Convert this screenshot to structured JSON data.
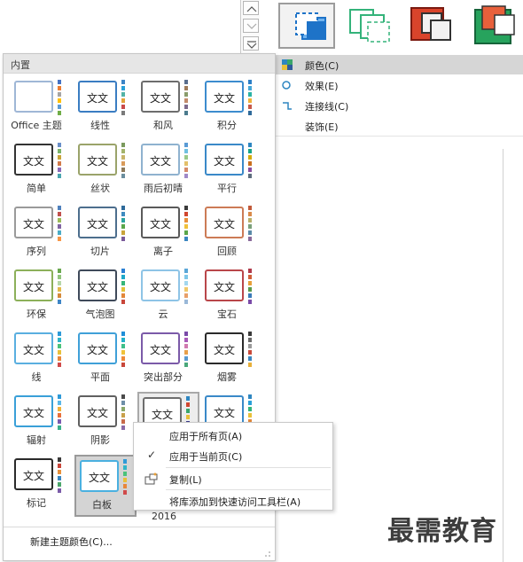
{
  "ribbon": {
    "spinner_icons": [
      "chevron-up-icon",
      "chevron-down-icon",
      "more-icon"
    ],
    "styles": [
      {
        "name": "filled-blue-style",
        "primary": "#1e73c8",
        "secondary": "#6fb3ef",
        "selected": true
      },
      {
        "name": "outline-green-style",
        "primary": "#34b37a",
        "secondary": "#ffffff",
        "selected": false
      },
      {
        "name": "filled-red-style",
        "primary": "#d9442b",
        "secondary": "#f2f2f2",
        "selected": false
      },
      {
        "name": "filled-green-style",
        "primary": "#27a35d",
        "secondary": "#e8603b",
        "selected": false
      }
    ]
  },
  "variant_menu": {
    "items": [
      {
        "label": "颜色(C)",
        "icon": "color-palette-icon",
        "active": true
      },
      {
        "label": "效果(E)",
        "icon": "effects-circle-icon",
        "active": false
      },
      {
        "label": "连接线(C)",
        "icon": "connector-icon",
        "active": false
      },
      {
        "label": "装饰(E)",
        "icon": "",
        "active": false
      }
    ]
  },
  "gallery": {
    "header": "内置",
    "thumb_text": "文文",
    "year_text": "2016",
    "themes": [
      {
        "label": "Office 主题",
        "border": "#9fb7d6",
        "palette": [
          "#4472c4",
          "#ed7d31",
          "#a5a5a5",
          "#ffc000",
          "#5b9bd5",
          "#70ad47"
        ],
        "show_text": false
      },
      {
        "label": "线性",
        "border": "#3a7dc2",
        "palette": [
          "#3d85c6",
          "#2aa0d8",
          "#53b3a6",
          "#e3a33a",
          "#c94a4a",
          "#7a7a7a"
        ],
        "show_text": true
      },
      {
        "label": "和风",
        "border": "#6d6d6d",
        "palette": [
          "#5a6e8e",
          "#a07c5b",
          "#8a9c6b",
          "#c28b6b",
          "#7d6b8d",
          "#4b7b8d"
        ],
        "show_text": true
      },
      {
        "label": "积分",
        "border": "#3c8cce",
        "palette": [
          "#2c7fc7",
          "#46a7d8",
          "#2bb3a5",
          "#f0b23a",
          "#c85a4a",
          "#2f6a9a"
        ],
        "show_text": true
      },
      {
        "label": "简单",
        "border": "#333333",
        "palette": [
          "#6a8fc9",
          "#7ab36a",
          "#c9a53a",
          "#d27a4a",
          "#8a6ab8",
          "#4aa6b0"
        ],
        "show_text": true
      },
      {
        "label": "丝状",
        "border": "#9aa36a",
        "palette": [
          "#7b9a5e",
          "#a3b36b",
          "#c8b46a",
          "#d99b5a",
          "#8d7a5b",
          "#6b8e9e"
        ],
        "show_text": true
      },
      {
        "label": "雨后初晴",
        "border": "#8fb2cf",
        "palette": [
          "#5a9bd5",
          "#70c0e0",
          "#9ac98a",
          "#e3c06a",
          "#d58a6a",
          "#a08ac8"
        ],
        "show_text": true
      },
      {
        "label": "平行",
        "border": "#3a89c8",
        "palette": [
          "#2e86c1",
          "#17a589",
          "#d4ac0d",
          "#ca6f1e",
          "#884ea0",
          "#5d6d7e"
        ],
        "show_text": true
      },
      {
        "label": "序列",
        "border": "#9a9a9a",
        "palette": [
          "#4f81bd",
          "#c0504d",
          "#9bbb59",
          "#8064a2",
          "#4bacc6",
          "#f79646"
        ],
        "show_text": true
      },
      {
        "label": "切片",
        "border": "#4d6e8d",
        "palette": [
          "#2e6a9a",
          "#3e8bc0",
          "#2ba3a0",
          "#5aa64a",
          "#c9a43a",
          "#7a5a9a"
        ],
        "show_text": true
      },
      {
        "label": "离子",
        "border": "#5a5a5a",
        "palette": [
          "#3a3a3a",
          "#d0462f",
          "#e8903a",
          "#f0c03a",
          "#5aa64a",
          "#3a86c0"
        ],
        "show_text": true
      },
      {
        "label": "回顾",
        "border": "#cc7b56",
        "palette": [
          "#c25a3a",
          "#d98a4a",
          "#b8b06a",
          "#7aa07a",
          "#5a8aa8",
          "#8a6a9a"
        ],
        "show_text": true
      },
      {
        "label": "环保",
        "border": "#8cb05a",
        "palette": [
          "#6aa84f",
          "#93c47d",
          "#b6d7a8",
          "#e3b94a",
          "#d58a3a",
          "#3d85c6"
        ],
        "show_text": true
      },
      {
        "label": "气泡图",
        "border": "#3f4a5a",
        "palette": [
          "#2a7fd4",
          "#1fa8c9",
          "#34b57a",
          "#e2c13a",
          "#e2873a",
          "#c9463a"
        ],
        "show_text": true
      },
      {
        "label": "云",
        "border": "#8ec4e6",
        "palette": [
          "#5aa7d8",
          "#7fc7e8",
          "#a3d7ef",
          "#f0c86a",
          "#e8a06a",
          "#9ab8d8"
        ],
        "show_text": true
      },
      {
        "label": "宝石",
        "border": "#b9464a",
        "palette": [
          "#b03a4a",
          "#d0603a",
          "#e8a03a",
          "#5a9a4a",
          "#3a7ab8",
          "#7a4aa8"
        ],
        "show_text": true
      },
      {
        "label": "线",
        "border": "#5aafe0",
        "palette": [
          "#2e9ad8",
          "#30b5c8",
          "#4ac27a",
          "#e8c03a",
          "#e8873a",
          "#d04a4a"
        ],
        "show_text": true
      },
      {
        "label": "平面",
        "border": "#3fa0d8",
        "palette": [
          "#1f8ed8",
          "#23b1c8",
          "#3fbf8a",
          "#f0c23a",
          "#ef8a3a",
          "#c8463a"
        ],
        "show_text": true
      },
      {
        "label": "突出部分",
        "border": "#7b5aa8",
        "palette": [
          "#7a4aa8",
          "#a85ab8",
          "#d07ab0",
          "#e8a04a",
          "#5a9ad0",
          "#4aa87a"
        ],
        "show_text": true
      },
      {
        "label": "烟雾",
        "border": "#2a2a2a",
        "palette": [
          "#3a3a3a",
          "#6a6a6a",
          "#9a9a9a",
          "#c94a3a",
          "#3a86c0",
          "#e8b03a"
        ],
        "show_text": true
      },
      {
        "label": "辐射",
        "border": "#3aa0d8",
        "palette": [
          "#2e9ad8",
          "#5ab8e8",
          "#f0b23a",
          "#e8703a",
          "#7a5ab0",
          "#3ab08a"
        ],
        "show_text": true
      },
      {
        "label": "阴影",
        "border": "#606060",
        "palette": [
          "#4a4a4a",
          "#6e8ea8",
          "#8aa86a",
          "#c8a04a",
          "#c86a4a",
          "#8a6aa8"
        ],
        "show_text": true
      },
      {
        "label": "",
        "border": "#6d6d6d",
        "palette": [
          "#2e86c1",
          "#d0462f",
          "#3aa66a",
          "#e8c03a",
          "#3a3a8a",
          "#8a8a8a"
        ],
        "show_text": true
      },
      {
        "label": "",
        "border": "#3a89c8",
        "palette": [
          "#2e86c1",
          "#2aa0d8",
          "#34b57a",
          "#e8c03a",
          "#e2873a",
          "#c9463a"
        ],
        "show_text": true
      },
      {
        "label": "标记",
        "border": "#2a2a2a",
        "palette": [
          "#3a3a3a",
          "#c9463a",
          "#e8903a",
          "#3a86c0",
          "#4aa66a",
          "#7a5aa8"
        ],
        "show_text": true
      },
      {
        "label": "白板",
        "border": "#4ab0e0",
        "palette": [
          "#2e9ad8",
          "#30b5c8",
          "#4ac27a",
          "#e8c03a",
          "#e8873a",
          "#d04a4a"
        ],
        "show_text": true
      }
    ],
    "footer": "新建主题颜色(C)..."
  },
  "context_menu": {
    "items": [
      {
        "label": "应用于所有页(A)",
        "checked": false,
        "icon": ""
      },
      {
        "label": "应用于当前页(C)",
        "checked": true,
        "icon": ""
      },
      {
        "label": "复制(L)",
        "checked": false,
        "icon": "copy-gallery-icon"
      },
      {
        "label": "将库添加到快速访问工具栏(A)",
        "checked": false,
        "icon": ""
      }
    ]
  },
  "watermark": "最需教育"
}
